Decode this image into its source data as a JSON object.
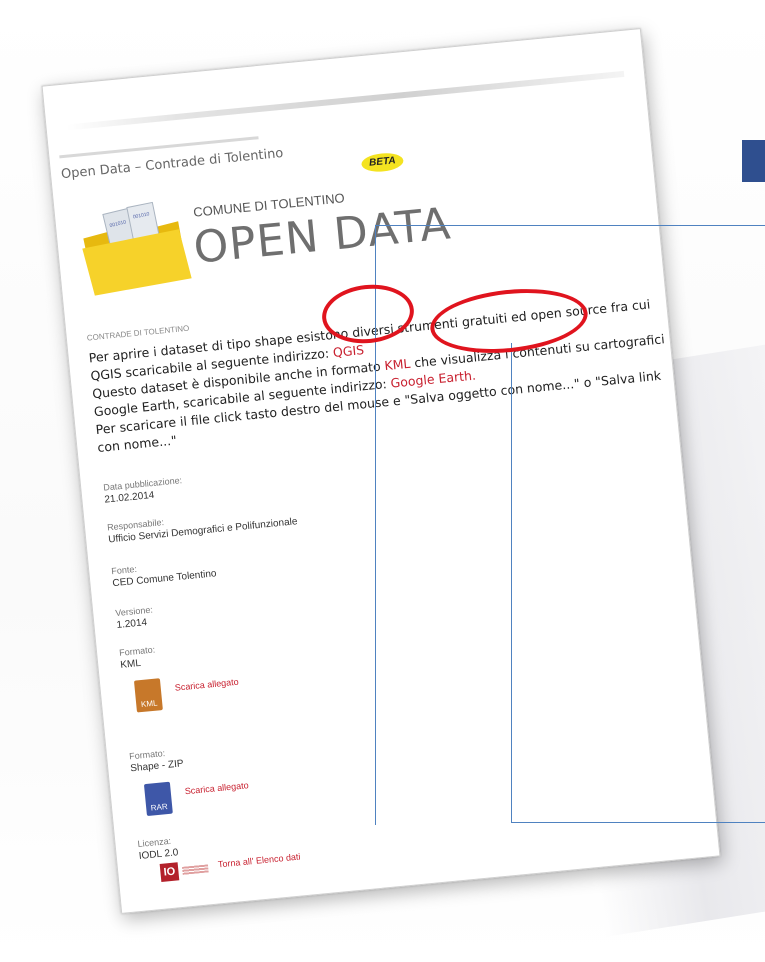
{
  "document": {
    "page_title": "Open Data – Contrade di Tolentino",
    "beta_badge": "BETA",
    "logo_sub": "COMUNE DI TOLENTINO",
    "logo_main": "OPEN DATA",
    "section_header": "CONTRADE DI TOLENTINO",
    "description": {
      "p1": "Per aprire i dataset di tipo shape esistono diversi strumenti gratuiti ed open source fra cui QGIS scaricabile al seguente indirizzo: ",
      "link_qgis": "QGIS",
      "p2": "Questo dataset è disponibile anche in formato ",
      "link_kml": "KML",
      "p3": " che visualizza i contenuti su cartografici Google Earth, scaricabile al seguente indirizzo: ",
      "link_google_earth": "Google Earth.",
      "p4": "Per scaricare il file click tasto destro del mouse e \"Salva oggetto con nome...\" o \"Salva link con nome...\""
    },
    "meta": {
      "data_pubblicazione_label": "Data pubblicazione:",
      "data_pubblicazione_value": "21.02.2014",
      "responsabile_label": "Responsabile:",
      "responsabile_value": "Ufficio Servizi Demografici e Polifunzionale",
      "fonte_label": "Fonte:",
      "fonte_value": "CED Comune Tolentino",
      "versione_label": "Versione:",
      "versione_value": "1.2014",
      "formato1_label": "Formato:",
      "formato1_value": "KML",
      "formato2_label": "Formato:",
      "formato2_value": "Shape - ZIP",
      "licenza_label": "Licenza:",
      "licenza_value": "IODL 2.0"
    },
    "downloads": {
      "kml_icon_text": "KML",
      "kml_link": "Scarica allegato",
      "rar_icon_text": "RAR",
      "rar_link": "Scarica allegato"
    },
    "footer": {
      "iodl_logo": "IO",
      "back_link": "Torna all' Elenco dati"
    }
  },
  "colors": {
    "highlight_ring": "#e0141e",
    "callout_line": "#4f82c0",
    "link_red": "#c8202f",
    "beta_yellow": "#f4e321",
    "accent_square": "#2f4f8f"
  }
}
